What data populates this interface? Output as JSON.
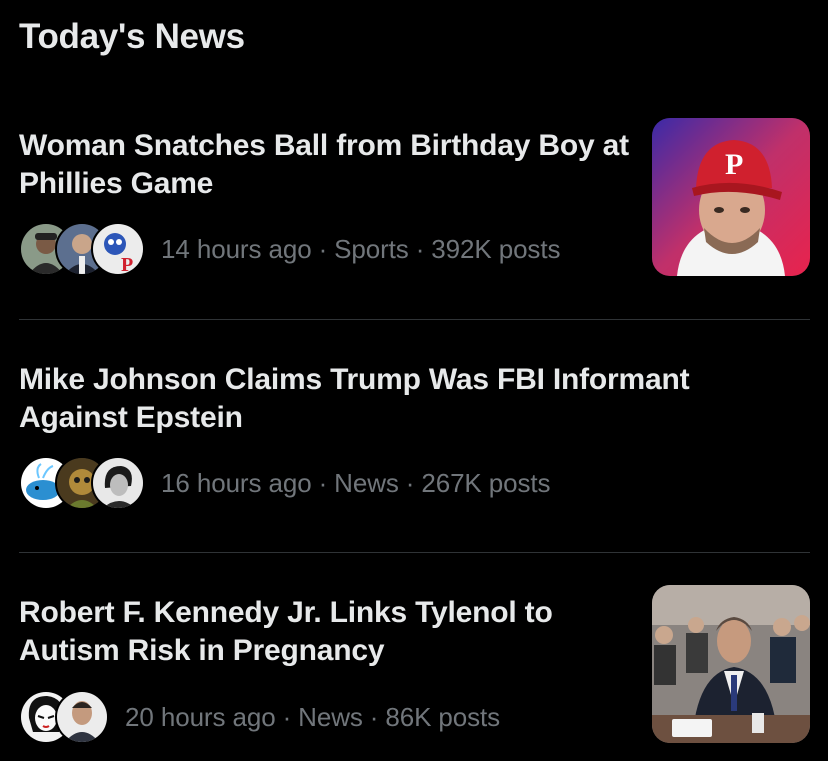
{
  "section": {
    "title": "Today's News"
  },
  "separator": "·",
  "items": [
    {
      "headline": "Woman Snatches Ball from Birthday Boy at Phillies Game",
      "time": "14 hours ago",
      "category": "Sports",
      "posts": "392K posts",
      "avatar_count": 3,
      "has_thumbnail": true,
      "thumbnail_label": "P"
    },
    {
      "headline": "Mike Johnson Claims Trump Was FBI Informant Against Epstein",
      "time": "16 hours ago",
      "category": "News",
      "posts": "267K posts",
      "avatar_count": 3,
      "has_thumbnail": false
    },
    {
      "headline": "Robert F. Kennedy Jr. Links Tylenol to Autism Risk in Pregnancy",
      "time": "20 hours ago",
      "category": "News",
      "posts": "86K posts",
      "avatar_count": 2,
      "has_thumbnail": true
    }
  ],
  "colors": {
    "background": "#000000",
    "headline": "#e7e9ea",
    "meta": "#71767b",
    "divider": "#2f3336",
    "phillies_red": "#d0202e"
  }
}
